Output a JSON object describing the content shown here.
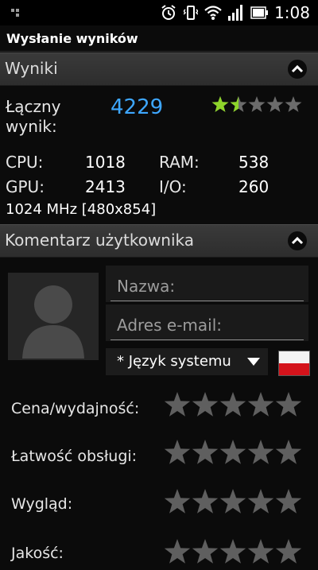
{
  "status_bar": {
    "time": "1:08"
  },
  "title": "Wysłanie wyników",
  "results_section": {
    "header": "Wyniki",
    "total_label_line1": "Łączny",
    "total_label_line2": "wynik:",
    "total_score": "4229",
    "score_rating": 1.5,
    "stats": [
      {
        "label": "CPU:",
        "value": "1018"
      },
      {
        "label": "RAM:",
        "value": "538"
      },
      {
        "label": "GPU:",
        "value": "2413"
      },
      {
        "label": "I/O:",
        "value": "260"
      }
    ],
    "device_info": "1024 MHz [480x854]"
  },
  "comment_section": {
    "header": "Komentarz użytkownika",
    "name_placeholder": "Nazwa:",
    "email_placeholder": "Adres e-mail:",
    "language": "* Język systemu",
    "ratings": [
      {
        "label": "Cena/wydajność:",
        "value": 0
      },
      {
        "label": "Łatwość obsługi:",
        "value": 0
      },
      {
        "label": "Wygląd:",
        "value": 0
      },
      {
        "label": "Jakość:",
        "value": 0
      }
    ]
  },
  "colors": {
    "score": "#3ea7ff",
    "star_filled": "#8ed42a",
    "star_empty": "#6b6b6b"
  },
  "icons": [
    "alarm-icon",
    "vibrate-icon",
    "wifi-icon",
    "signal-icon",
    "battery-icon",
    "notification-icon",
    "chevron-up-icon",
    "avatar-placeholder-icon",
    "poland-flag-icon"
  ]
}
